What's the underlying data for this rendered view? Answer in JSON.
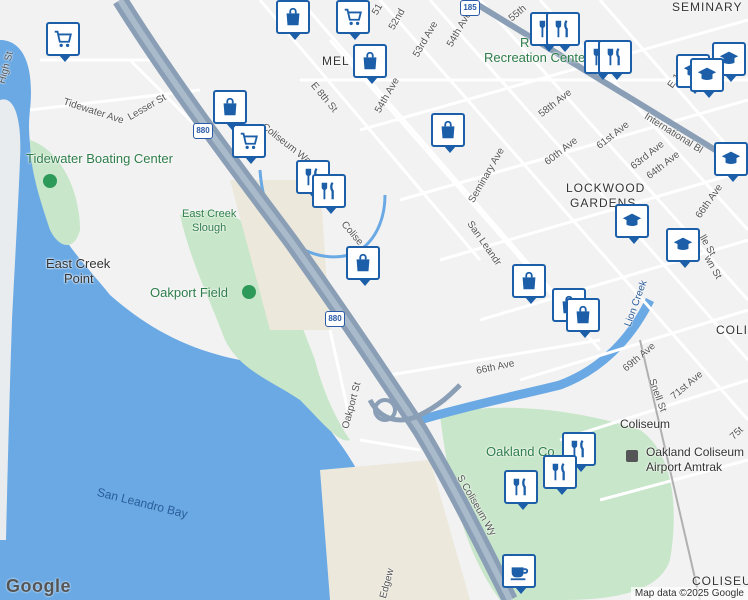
{
  "colors": {
    "pin_border": "#1c5fa8",
    "water": "#6aa9e4",
    "park": "#c8e6c9",
    "freeway": "#8a9fb5",
    "land": "#f2f2f2"
  },
  "streets": {
    "high_st": "High St",
    "tidewater_ave": "Tidewater Ave",
    "lesser_st": "Lesser St",
    "coliseum_way": "Coliseum Way",
    "coliseum_way_2": "Colise",
    "e_8th_st": "E 8th St",
    "mel": "MEL",
    "seminary_ave": "Seminary Ave",
    "san_leandro": "San Leandr",
    "ave_51": "51",
    "ave_52": "52nd",
    "ave_53": "53rd Ave",
    "ave_54a": "54th Ave",
    "ave_55": "55th",
    "ave_54b": "54th Ave",
    "ave_58": "58th Ave",
    "ave_60": "60th Ave",
    "ave_61": "61st Ave",
    "ave_63": "63rd Ave",
    "ave_64": "64th Ave",
    "ave_66": "66th Ave",
    "ave_66b": "66th Ave",
    "ave_69": "69th Ave",
    "ave_71": "71st Ave",
    "snell_st": "Snell St",
    "international": "International Bl",
    "e_16th": "E 16th",
    "ave_75": "75t",
    "oakport_st": "Oakport St",
    "s_coliseum_wy": "S Coliseum Wy",
    "edgewater": "Edgew",
    "lion_creek": "Lion Creek",
    "hall_st": "lle St",
    "wn_st": "wn St"
  },
  "areas": {
    "seminary": "SEMINARY",
    "lockwood": "LOCKWOOD",
    "gardens": "GARDENS",
    "coli_a": "COLI",
    "coli_b": "COLISEU"
  },
  "places": {
    "tidewater": "Tidewater Boating Center",
    "east_creek_point_1": "East Creek",
    "east_creek_point_2": "Point",
    "east_creek_slough_1": "East Creek",
    "east_creek_slough_2": "Slough",
    "oakport_field": "Oakport Field",
    "recreation": "Recreation Center",
    "recreation_r": "R",
    "oakland_col": "Oakland Co",
    "san_leandro_bay": "San Leandro Bay",
    "coliseum_station": "Coliseum",
    "amtrak_1": "Oakland Coliseum",
    "amtrak_2": "Airport Amtrak"
  },
  "shields": {
    "i880_a": "880",
    "i880_b": "880",
    "hwy185": "185"
  },
  "pins": [
    {
      "type": "cart-icon"
    },
    {
      "type": "bag-icon"
    },
    {
      "type": "cart-icon"
    },
    {
      "type": "bag-icon"
    },
    {
      "type": "cart-icon"
    },
    {
      "type": "fork-knife-icon"
    },
    {
      "type": "fork-knife-icon"
    },
    {
      "type": "fork-knife-icon"
    },
    {
      "type": "fork-knife-icon"
    },
    {
      "type": "school-icon"
    },
    {
      "type": "school-icon"
    },
    {
      "type": "school-icon"
    },
    {
      "type": "bag-icon"
    },
    {
      "type": "fork-knife-icon"
    },
    {
      "type": "fork-knife-icon"
    },
    {
      "type": "bag-icon"
    },
    {
      "type": "bag-icon"
    },
    {
      "type": "school-icon"
    },
    {
      "type": "school-icon"
    },
    {
      "type": "bag-icon"
    },
    {
      "type": "bag-icon"
    },
    {
      "type": "bag-icon"
    },
    {
      "type": "fork-knife-icon"
    },
    {
      "type": "fork-knife-icon"
    },
    {
      "type": "fork-knife-icon"
    },
    {
      "type": "coffee-icon"
    },
    {
      "type": "school-icon"
    }
  ],
  "branding": {
    "logo": "Google",
    "attribution": "Map data ©2025 Google"
  }
}
